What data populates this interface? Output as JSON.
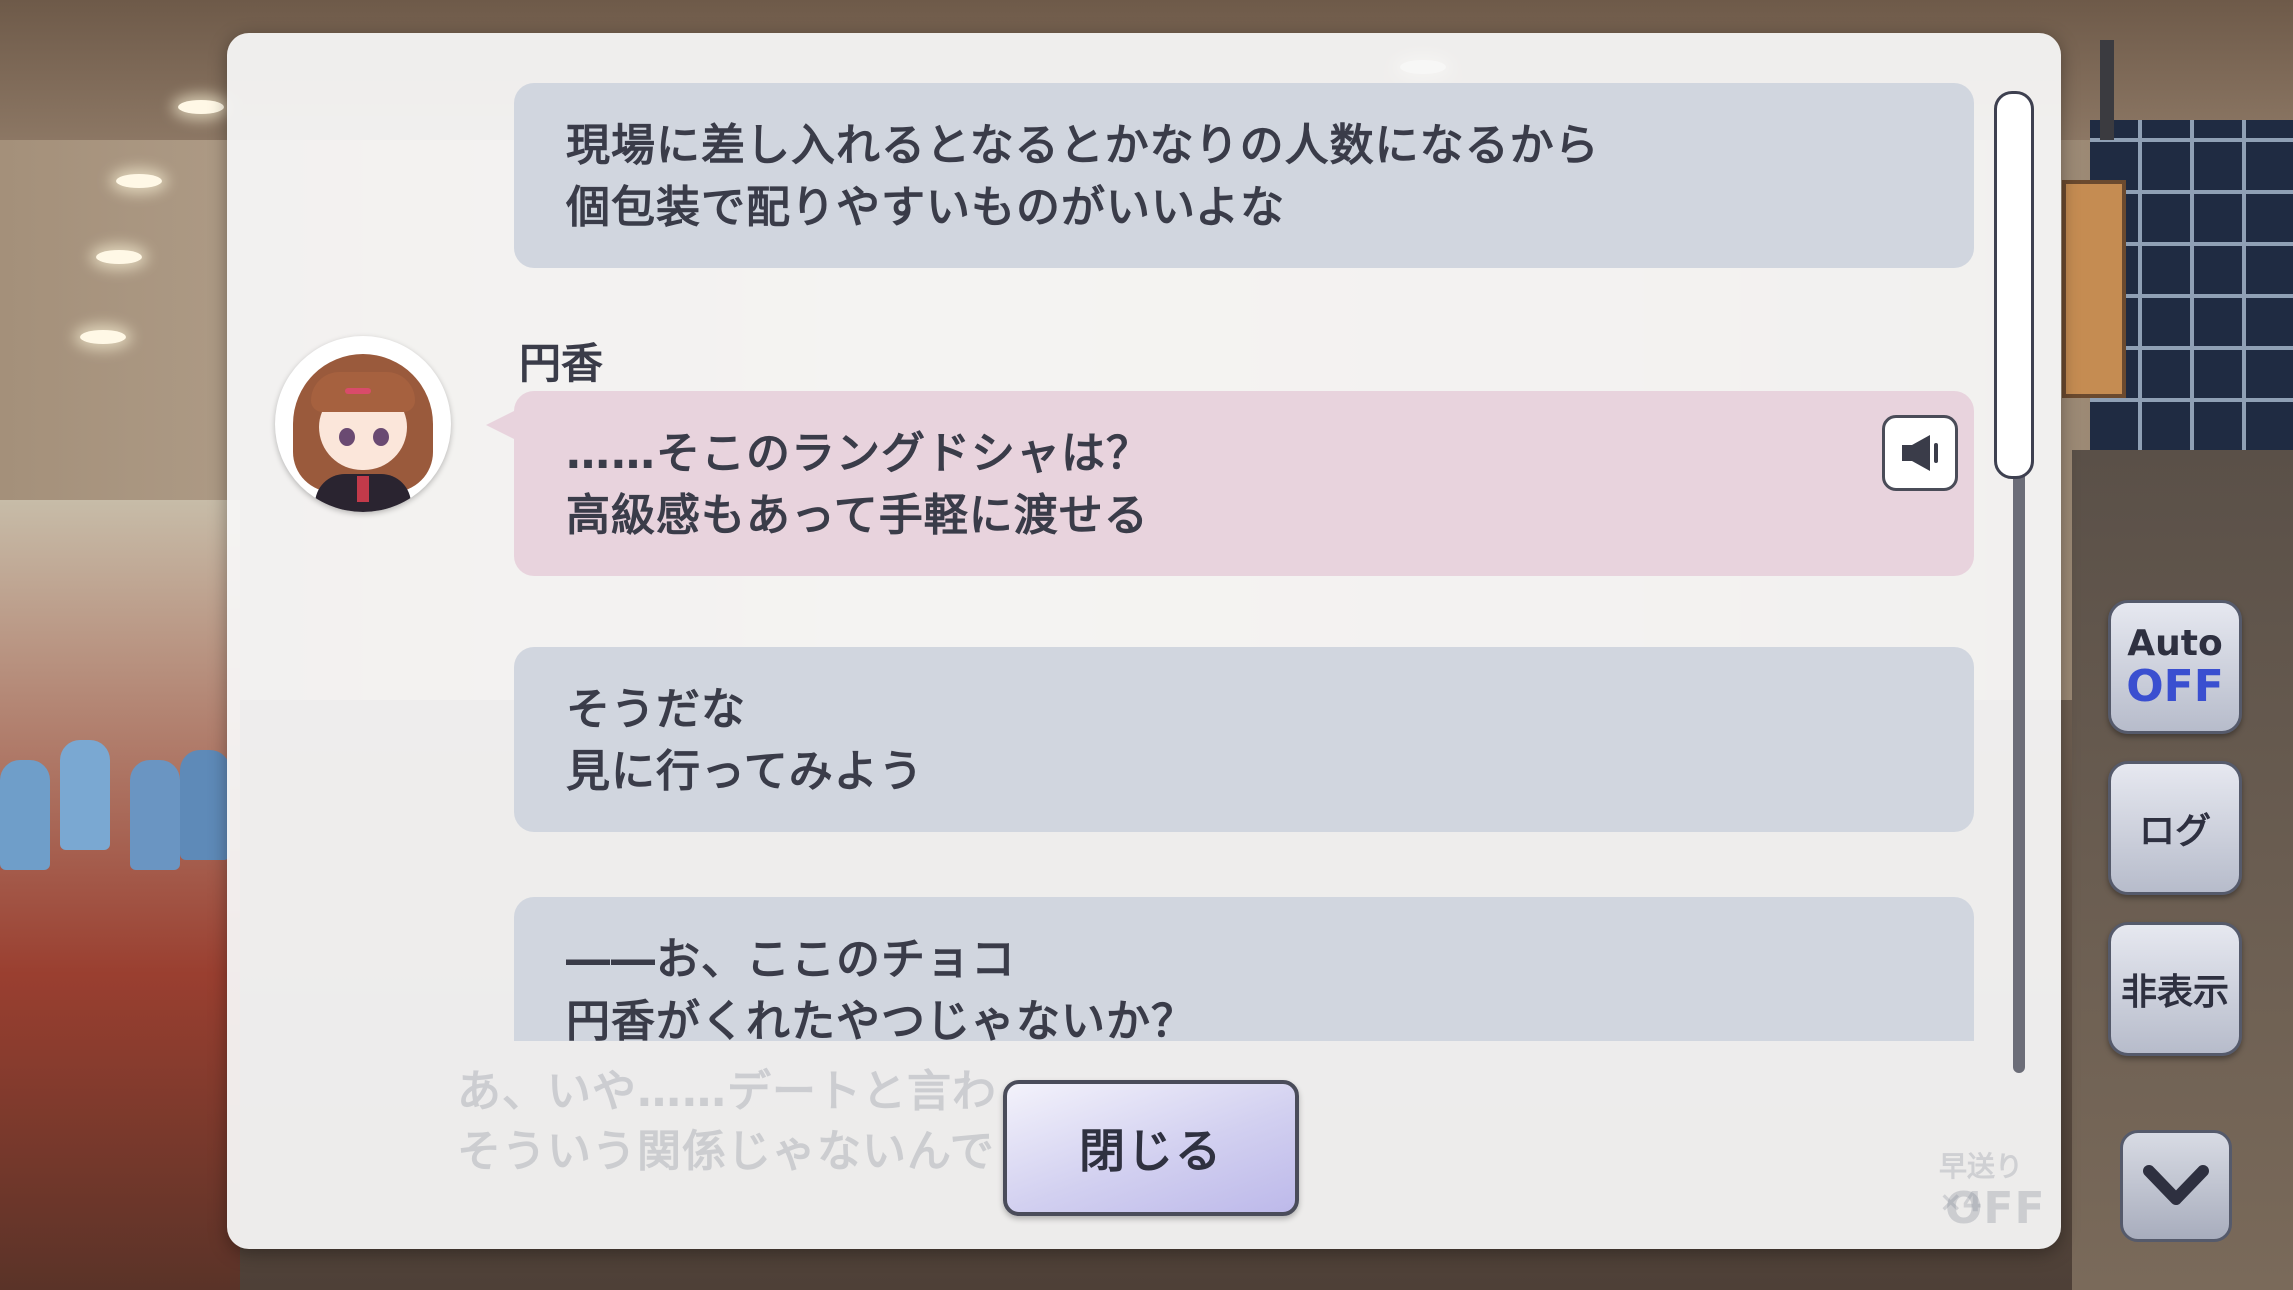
{
  "log": {
    "entries": [
      {
        "speaker": "",
        "lines": [
          "現場に差し入れるとなるとかなりの人数になるから",
          "個包装で配りやすいものがいいよな"
        ]
      },
      {
        "speaker": "円香",
        "lines": [
          "……そこのラングドシャは？",
          "高級感もあって手軽に渡せる"
        ]
      },
      {
        "speaker": "",
        "lines": [
          "そうだな",
          "見に行ってみよう"
        ]
      },
      {
        "speaker": "",
        "lines": [
          "――お、ここのチョコ",
          "円香がくれたやつじゃないか？"
        ]
      }
    ]
  },
  "background_dialog": {
    "lines": [
      "あ、いや……デートと言わ",
      "そういう関係じゃないんで"
    ],
    "fast_forward_label": "早送り×4",
    "fast_forward_state": "OFF"
  },
  "close_label": "閉じる",
  "side_controls": {
    "auto_label": "Auto",
    "auto_state": "OFF",
    "log_label": "ログ",
    "hide_label": "非表示"
  },
  "icons": {
    "voice": "speaker-icon",
    "down": "chevron-down-icon"
  },
  "colors": {
    "bubble_default": "#d1d6df",
    "bubble_voiced": "#e8d3dd",
    "auto_state": "#3a4fd0"
  }
}
